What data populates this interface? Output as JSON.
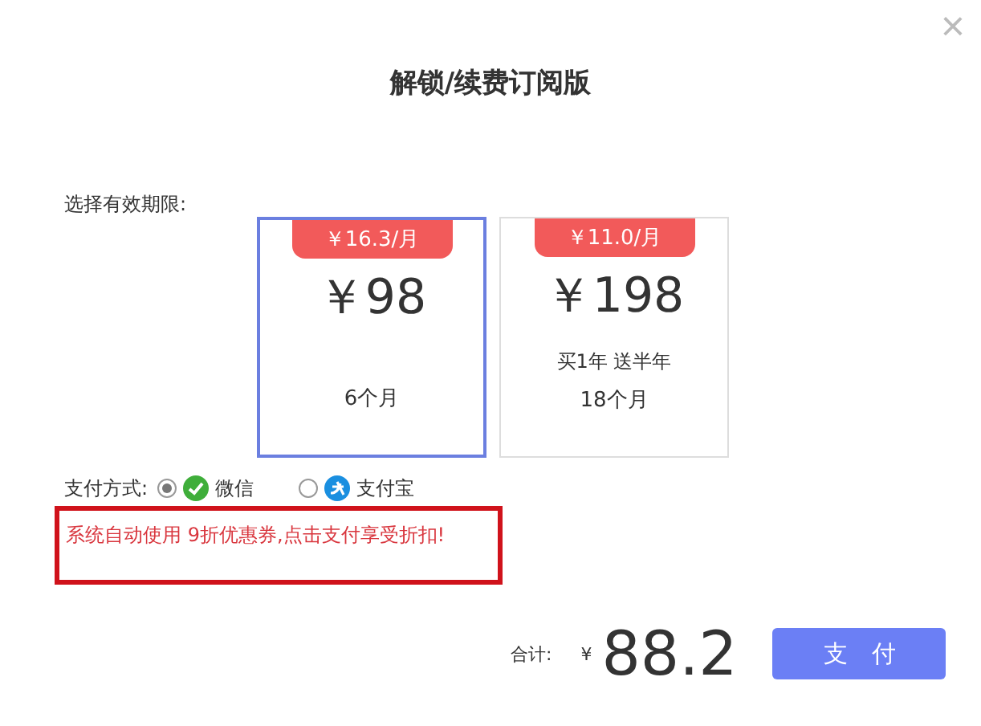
{
  "dialog": {
    "title": "解锁/续费订阅版",
    "close": "×"
  },
  "period_label": "选择有效期限:",
  "plans": [
    {
      "badge": "￥16.3/月",
      "price": "￥98",
      "duration": "6个月",
      "selected": true
    },
    {
      "badge": "￥11.0/月",
      "price": "￥198",
      "note": "买1年 送半年",
      "duration": "18个月",
      "selected": false
    }
  ],
  "payment": {
    "label": "支付方式:",
    "methods": [
      {
        "kind": "wechat",
        "label": "微信",
        "selected": true
      },
      {
        "kind": "alipay",
        "label": "支付宝",
        "selected": false
      }
    ]
  },
  "notice": "系统自动使用 9折优惠券,点击支付享受折扣!",
  "total": {
    "label": "合计:",
    "currency": "¥",
    "amount": "88.2"
  },
  "pay_button": "支　付"
}
